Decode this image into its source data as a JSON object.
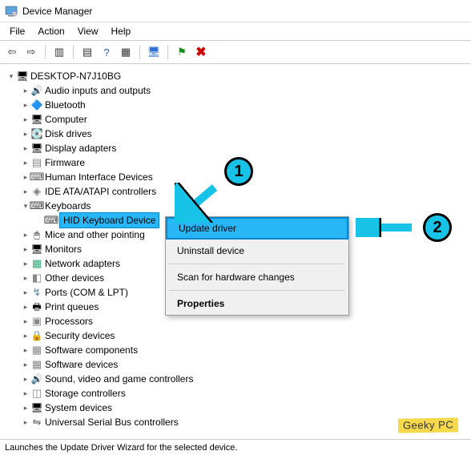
{
  "window": {
    "title": "Device Manager"
  },
  "menubar": [
    "File",
    "Action",
    "View",
    "Help"
  ],
  "tree": {
    "root": "DESKTOP-N7J10BG",
    "categories": [
      {
        "label": "Audio inputs and outputs",
        "icon": "ic-speaker"
      },
      {
        "label": "Bluetooth",
        "icon": "ic-bt"
      },
      {
        "label": "Computer",
        "icon": "ic-computer"
      },
      {
        "label": "Disk drives",
        "icon": "ic-disk"
      },
      {
        "label": "Display adapters",
        "icon": "ic-display"
      },
      {
        "label": "Firmware",
        "icon": "ic-fw"
      },
      {
        "label": "Human Interface Devices",
        "icon": "ic-hid"
      },
      {
        "label": "IDE ATA/ATAPI controllers",
        "icon": "ic-ide"
      },
      {
        "label": "Keyboards",
        "icon": "ic-kb",
        "expanded": true,
        "children": [
          {
            "label": "HID Keyboard Device",
            "icon": "ic-kb",
            "selected": true
          }
        ]
      },
      {
        "label": "Mice and other pointing",
        "icon": "ic-mouse"
      },
      {
        "label": "Monitors",
        "icon": "ic-monitor"
      },
      {
        "label": "Network adapters",
        "icon": "ic-net"
      },
      {
        "label": "Other devices",
        "icon": "ic-other"
      },
      {
        "label": "Ports (COM & LPT)",
        "icon": "ic-port"
      },
      {
        "label": "Print queues",
        "icon": "ic-printq"
      },
      {
        "label": "Processors",
        "icon": "ic-proc"
      },
      {
        "label": "Security devices",
        "icon": "ic-sec"
      },
      {
        "label": "Software components",
        "icon": "ic-soft"
      },
      {
        "label": "Software devices",
        "icon": "ic-soft"
      },
      {
        "label": "Sound, video and game controllers",
        "icon": "ic-sound"
      },
      {
        "label": "Storage controllers",
        "icon": "ic-storage"
      },
      {
        "label": "System devices",
        "icon": "ic-sys"
      },
      {
        "label": "Universal Serial Bus controllers",
        "icon": "ic-usb"
      }
    ]
  },
  "context_menu": {
    "items": [
      {
        "label": "Update driver",
        "highlighted": true
      },
      {
        "label": "Uninstall device"
      },
      {
        "sep": true
      },
      {
        "label": "Scan for hardware changes"
      },
      {
        "sep": true
      },
      {
        "label": "Properties",
        "bold": true
      }
    ]
  },
  "statusbar": {
    "text": "Launches the Update Driver Wizard for the selected device."
  },
  "annotations": {
    "badge1": "1",
    "badge2": "2"
  },
  "watermark": "Geeky PC"
}
